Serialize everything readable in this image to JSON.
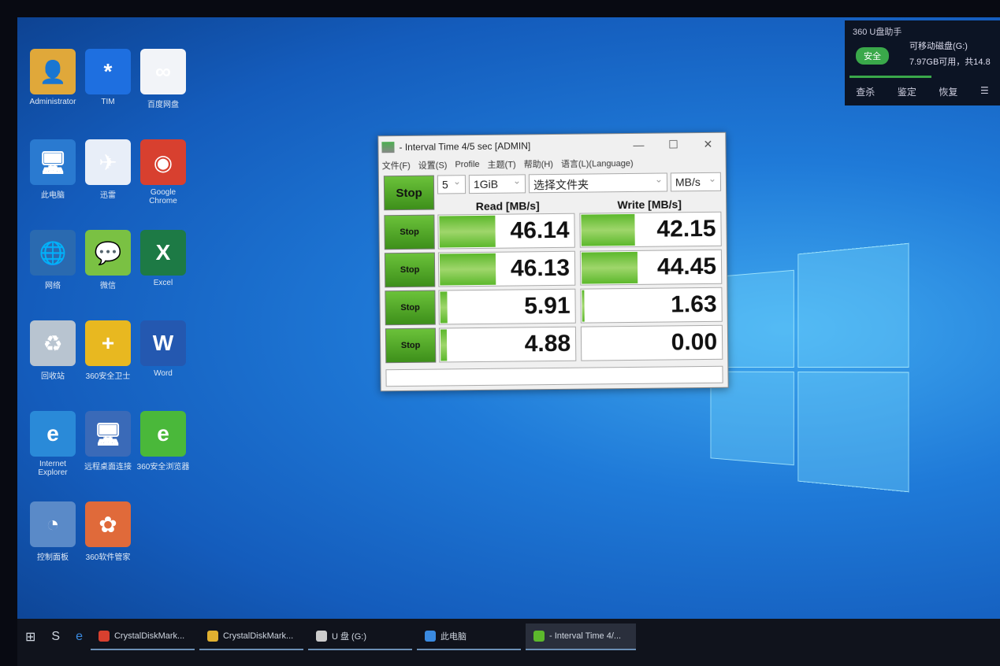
{
  "desktop": {
    "icons": [
      {
        "label": "Administrator",
        "glyph": "👤",
        "color": "#e0a83a"
      },
      {
        "label": "TIM",
        "glyph": "*",
        "color": "#1e6fe0"
      },
      {
        "label": "百度网盘",
        "glyph": "∞",
        "color": "#f2f4f8"
      },
      {
        "label": "此电脑",
        "glyph": "🖥",
        "color": "#2a7ad0"
      },
      {
        "label": "迅雷",
        "glyph": "✈",
        "color": "#e8eef8"
      },
      {
        "label": "Google Chrome",
        "glyph": "◉",
        "color": "#d8402f"
      },
      {
        "label": "网络",
        "glyph": "🌐",
        "color": "#2a6ab0"
      },
      {
        "label": "微信",
        "glyph": "💬",
        "color": "#7ac143"
      },
      {
        "label": "Excel",
        "glyph": "X",
        "color": "#1d7a45"
      },
      {
        "label": "回收站",
        "glyph": "♻",
        "color": "#b8c4d0"
      },
      {
        "label": "360安全卫士",
        "glyph": "+",
        "color": "#e8b820"
      },
      {
        "label": "Word",
        "glyph": "W",
        "color": "#2458b0"
      },
      {
        "label": "Internet Explorer",
        "glyph": "e",
        "color": "#2a8ad8"
      },
      {
        "label": "远程桌面连接",
        "glyph": "🖥",
        "color": "#3a6ab8"
      },
      {
        "label": "360安全浏览器",
        "glyph": "e",
        "color": "#4ab83a"
      },
      {
        "label": "控制面板",
        "glyph": "◔",
        "color": "#5a8ac8"
      },
      {
        "label": "360软件管家",
        "glyph": "✿",
        "color": "#e06a3a"
      }
    ]
  },
  "app": {
    "title": "- Interval Time 4/5 sec [ADMIN]",
    "window_controls": {
      "minimize": "—",
      "maximize": "☐",
      "close": "✕"
    },
    "menu": [
      "文件(F)",
      "设置(S)",
      "Profile",
      "主题(T)",
      "帮助(H)",
      "语言(L)(Language)"
    ],
    "main_button": "Stop",
    "count": "5",
    "size": "1GiB",
    "folder": "选择文件夹",
    "unit": "MB/s",
    "read_header": "Read [MB/s]",
    "write_header": "Write [MB/s]",
    "max_mbps": 50,
    "rows": [
      {
        "button": "Stop",
        "read": "46.14",
        "write": "42.15"
      },
      {
        "button": "Stop",
        "read": "46.13",
        "write": "44.45"
      },
      {
        "button": "Stop",
        "read": "5.91",
        "write": "1.63"
      },
      {
        "button": "Stop",
        "read": "4.88",
        "write": "0.00"
      }
    ],
    "accent": "#5cb82c"
  },
  "usb_helper": {
    "title": "360 U盘助手",
    "badge": "安全",
    "drive": "可移动磁盘(G:)",
    "space": "7.97GB可用，共14.8",
    "actions": [
      "查杀",
      "鉴定",
      "恢复",
      "☰"
    ]
  },
  "taskbar": {
    "items": [
      "CrystalDiskMark...",
      "CrystalDiskMark...",
      "U 盘 (G:)",
      "此电脑",
      "- Interval Time 4/..."
    ]
  }
}
